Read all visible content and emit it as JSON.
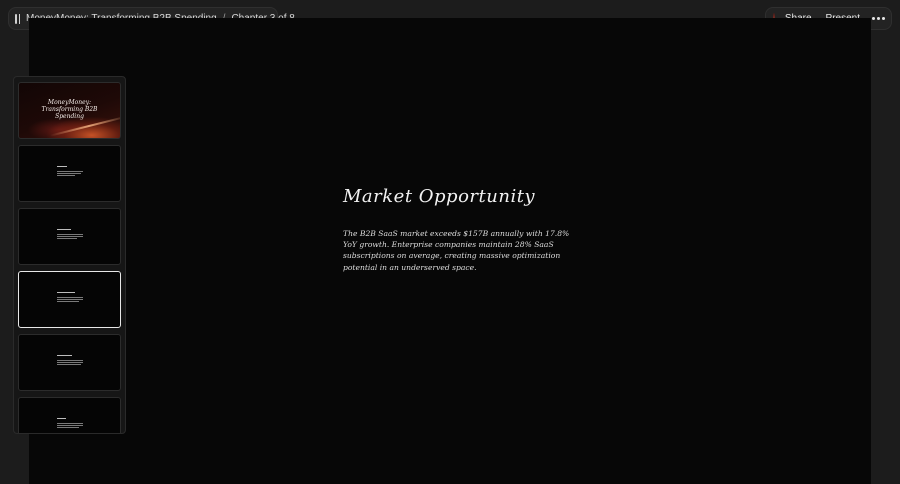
{
  "breadcrumb": {
    "title": "MoneyMoney: Transforming B2B Spending",
    "separator": "/",
    "chapter": "Chapter 3 of 8"
  },
  "toolbar": {
    "share_label": "Share",
    "present_label": "Present",
    "more_icon": "ellipsis-icon",
    "panel_icon": "sidebar-panel-icon"
  },
  "slide": {
    "title": "Market Opportunity",
    "body": "The B2B SaaS market exceeds $157B annually with 17.8% YoY growth. Enterprise companies maintain 28% SaaS subscriptions on average, creating massive optimization potential in an underserved space."
  },
  "thumbnails": {
    "cover_title": "MoneyMoney: Transforming B2B Spending",
    "active_index": 3
  },
  "colors": {
    "background": "#1c1c1c",
    "stage": "#070707",
    "text": "#e6e6e6",
    "cover_accent": "#cd5528"
  }
}
